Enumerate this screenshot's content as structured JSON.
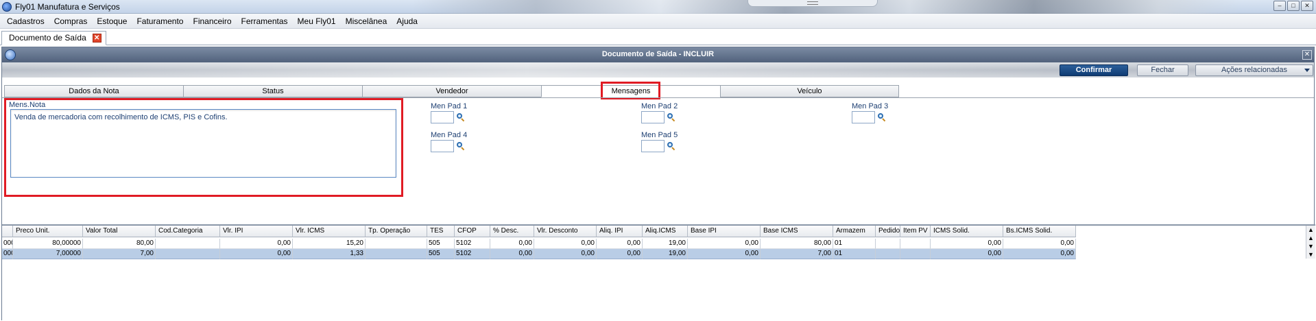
{
  "window": {
    "title": "Fly01 Manufatura e Serviços",
    "buttons": {
      "minimize": "–",
      "maximize": "□",
      "close": "✕"
    }
  },
  "menu": [
    "Cadastros",
    "Compras",
    "Estoque",
    "Faturamento",
    "Financeiro",
    "Ferramentas",
    "Meu Fly01",
    "Miscelânea",
    "Ajuda"
  ],
  "doc_tab": {
    "label": "Documento de Saída"
  },
  "dialog": {
    "title": "Documento de Saída - INCLUIR",
    "toolbar": {
      "confirm": "Confirmar",
      "close": "Fechar",
      "actions": "Ações relacionadas"
    }
  },
  "tabs": [
    "Dados da Nota",
    "Status",
    "Vendedor",
    "Mensagens",
    "Veículo"
  ],
  "active_tab": "Mensagens",
  "mensagens": {
    "mens_nota_label": "Mens.Nota",
    "mens_nota_value": "Venda de mercadoria com recolhimento de ICMS, PIS e Cofins.",
    "men_pad": [
      "Men Pad 1",
      "Men Pad 2",
      "Men Pad 3",
      "Men Pad 4",
      "Men Pad 5"
    ]
  },
  "grid": {
    "columns": [
      "",
      "Preco Unit.",
      "Valor Total",
      "Cod.Categoria",
      "Vlr. IPI",
      "Vlr. ICMS",
      "Tp. Operação",
      "TES",
      "CFOP",
      "% Desc.",
      "Vlr. Desconto",
      "Aliq. IPI",
      "Aliq.ICMS",
      "Base IPI",
      "Base ICMS",
      "Armazem",
      "Pedido",
      "Item PV",
      "ICMS Solid.",
      "Bs.ICMS Solid."
    ],
    "rows": [
      [
        "000",
        "80,00000",
        "80,00",
        "",
        "0,00",
        "15,20",
        "",
        "505",
        "5102",
        "0,00",
        "0,00",
        "0,00",
        "19,00",
        "0,00",
        "80,00",
        "01",
        "",
        "",
        "0,00",
        "0,00"
      ],
      [
        "000",
        "7,00000",
        "7,00",
        "",
        "0,00",
        "1,33",
        "",
        "505",
        "5102",
        "0,00",
        "0,00",
        "0,00",
        "19,00",
        "0,00",
        "7,00",
        "01",
        "",
        "",
        "0,00",
        "0,00"
      ]
    ]
  },
  "colors": {
    "highlight": "#e01b24",
    "confirm_button": "#0e3b73",
    "selected_row": "#b9cde6"
  }
}
